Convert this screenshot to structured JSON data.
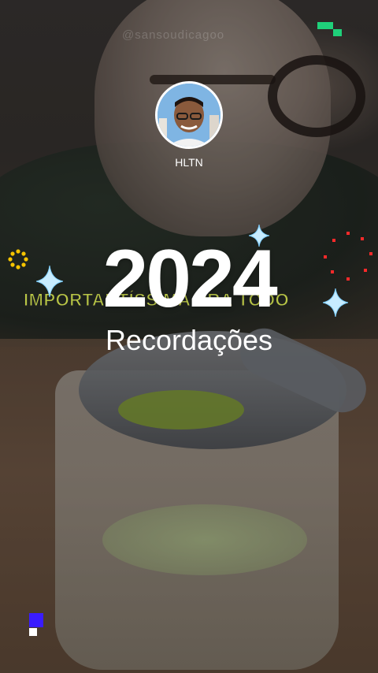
{
  "background": {
    "watermark": "@sansoudicagoo",
    "caption": "IMPORTANTÍSSIMA PRA TODO"
  },
  "profile": {
    "username": "HLTN"
  },
  "recap": {
    "year": "2024",
    "subtitle": "Recordações"
  },
  "colors": {
    "accent_green": "#1fd07a",
    "accent_blue": "#3a1cff",
    "sparkle": "#b9e6ff",
    "red_dots": "#ff2a2a",
    "gold_ring": "#f5c400"
  },
  "decorations": {
    "icons": [
      "sparkle-icon",
      "gold-ring-icon",
      "red-dots-circle-icon",
      "pixel-blocks-icon"
    ]
  }
}
